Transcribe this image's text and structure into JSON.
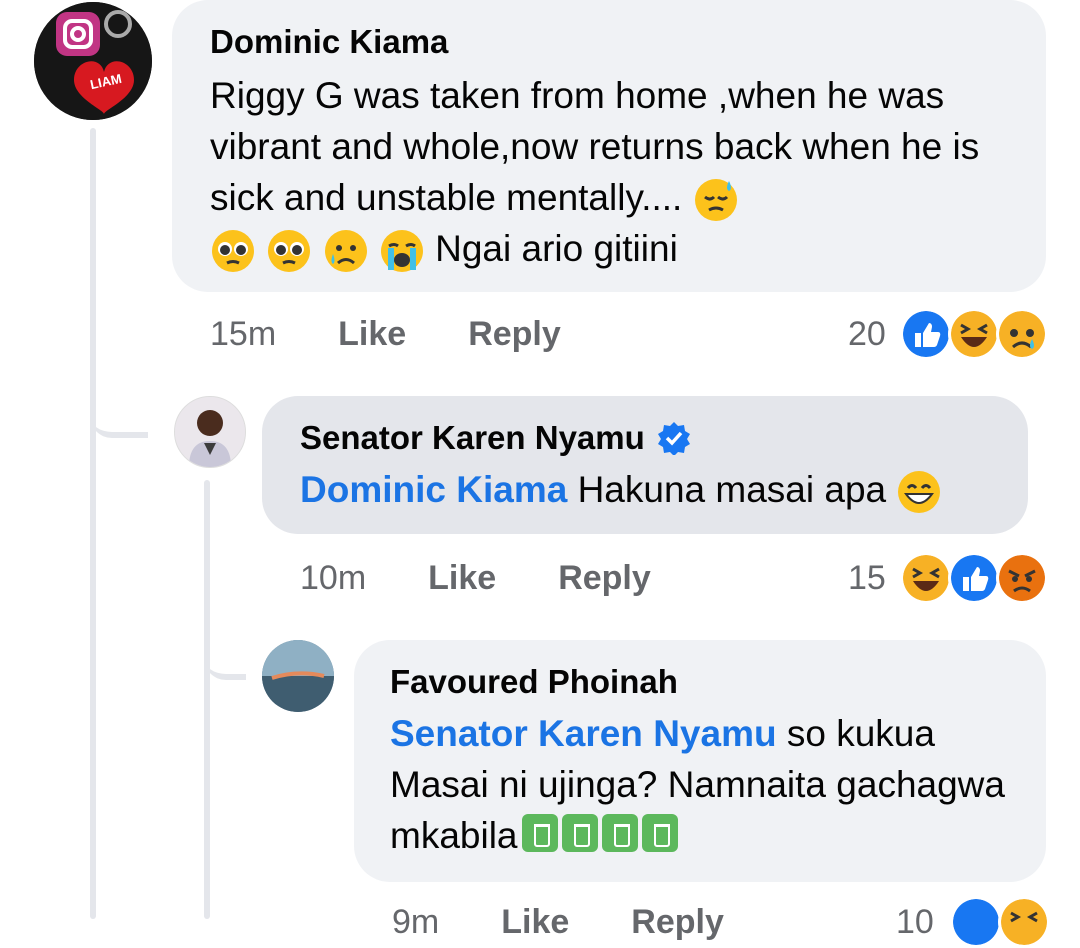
{
  "comments": [
    {
      "author": "Dominic Kiama",
      "text": "Riggy  G was taken from home  ,when he was vibrant and whole,now  returns back when he is sick and unstable mentally....",
      "text_tail": "Ngai ario gitiini",
      "time": "15m",
      "like": "Like",
      "reply": "Reply",
      "reaction_count": "20",
      "avatar_label": "LIAM"
    },
    {
      "author": "Senator Karen Nyamu",
      "verified": true,
      "mention": "Dominic Kiama",
      "text": "Hakuna masai apa",
      "time": "10m",
      "like": "Like",
      "reply": "Reply",
      "reaction_count": "15"
    },
    {
      "author": "Favoured Phoinah",
      "mention": "Senator Karen Nyamu",
      "text": "so kukua Masai ni ujinga? Namnaita gachagwa mkabila",
      "time": "9m",
      "like": "Like",
      "reply": "Reply",
      "reaction_count": "10"
    }
  ],
  "colors": {
    "accent": "#1b74e4",
    "bubble": "#f0f2f5",
    "bubble_selected": "#e4e6eb",
    "meta": "#65676b"
  },
  "icons": [
    "verified-badge-icon",
    "like-reaction-icon",
    "haha-reaction-icon",
    "sad-reaction-icon",
    "angry-reaction-icon",
    "trash-bin-emoji"
  ]
}
